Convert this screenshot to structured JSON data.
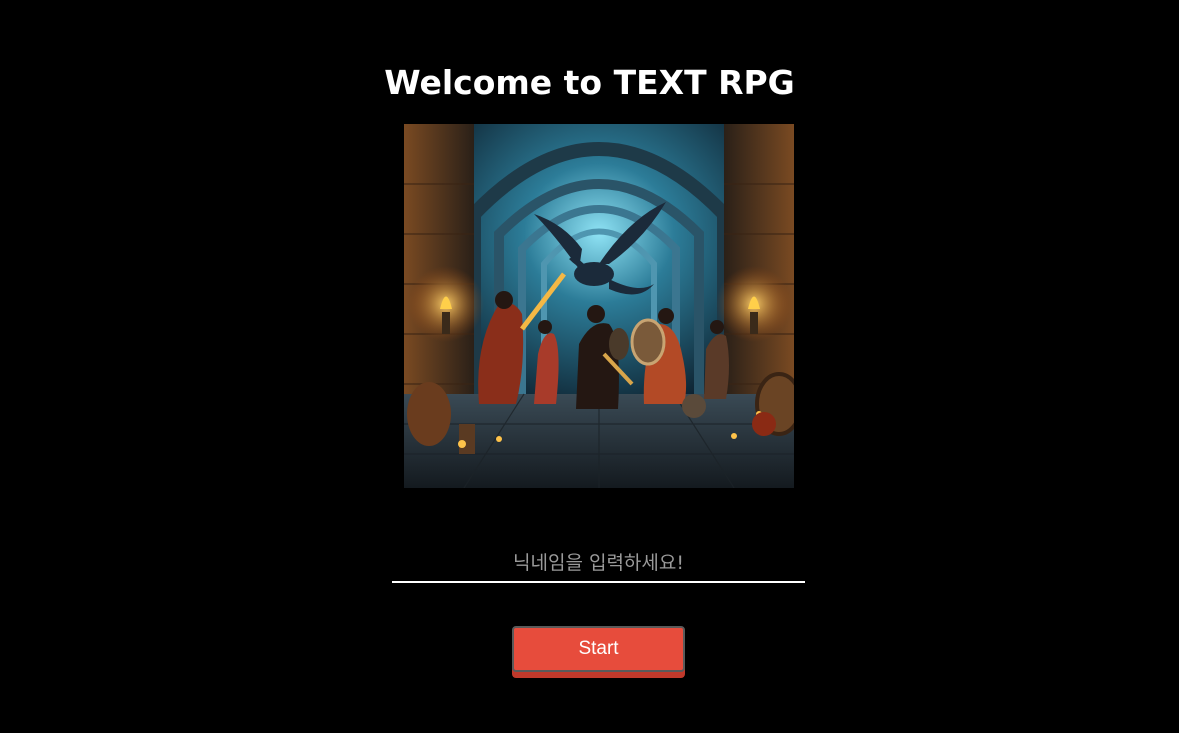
{
  "header": {
    "title": "Welcome to TEXT RPG"
  },
  "hero": {
    "image_name": "dungeon-party-dragon-illustration"
  },
  "form": {
    "nickname_placeholder": "닉네임을 입력하세요!",
    "nickname_value": "",
    "start_label": "Start"
  },
  "colors": {
    "background": "#000000",
    "title_text": "#ffffff",
    "button_fill": "#e74c3c",
    "button_shadow": "#c0392b",
    "input_underline": "#ffffff",
    "placeholder_text": "#9a9a9a"
  }
}
